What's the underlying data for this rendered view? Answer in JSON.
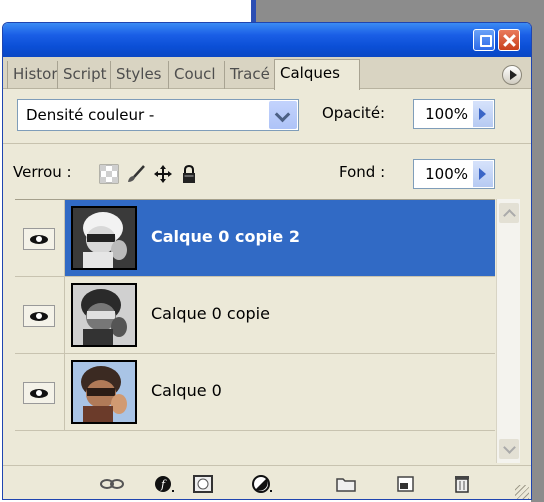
{
  "window": {
    "minimize_label": "",
    "close_label": ""
  },
  "tabs": [
    {
      "label": "Histor",
      "active": false
    },
    {
      "label": "Script",
      "active": false
    },
    {
      "label": "Styles",
      "active": false
    },
    {
      "label": "Coucl",
      "active": false
    },
    {
      "label": "Tracé",
      "active": false
    },
    {
      "label": "Calques",
      "active": true
    }
  ],
  "blend": {
    "mode": "Densité couleur -",
    "opacity_label": "Opacité:",
    "opacity_value": "100%"
  },
  "lock": {
    "label": "Verrou :",
    "fill_label": "Fond :",
    "fill_value": "100%",
    "icons": [
      "lock-transparent-icon",
      "lock-brush-icon",
      "lock-move-icon",
      "lock-all-icon"
    ]
  },
  "layers": [
    {
      "name": "Calque 0 copie 2",
      "selected": true,
      "thumb": "inverted-portrait"
    },
    {
      "name": "Calque 0 copie",
      "selected": false,
      "thumb": "grayscale-portrait"
    },
    {
      "name": "Calque 0",
      "selected": false,
      "thumb": "color-portrait"
    }
  ],
  "bottom_icons": [
    "link-icon",
    "layer-style-icon",
    "mask-icon",
    "adjustment-icon",
    "group-folder-icon",
    "new-layer-icon",
    "trash-icon"
  ],
  "colors": {
    "selection": "#316ac5",
    "panel": "#ece9d8",
    "titlebar": "#0b4fd6"
  }
}
